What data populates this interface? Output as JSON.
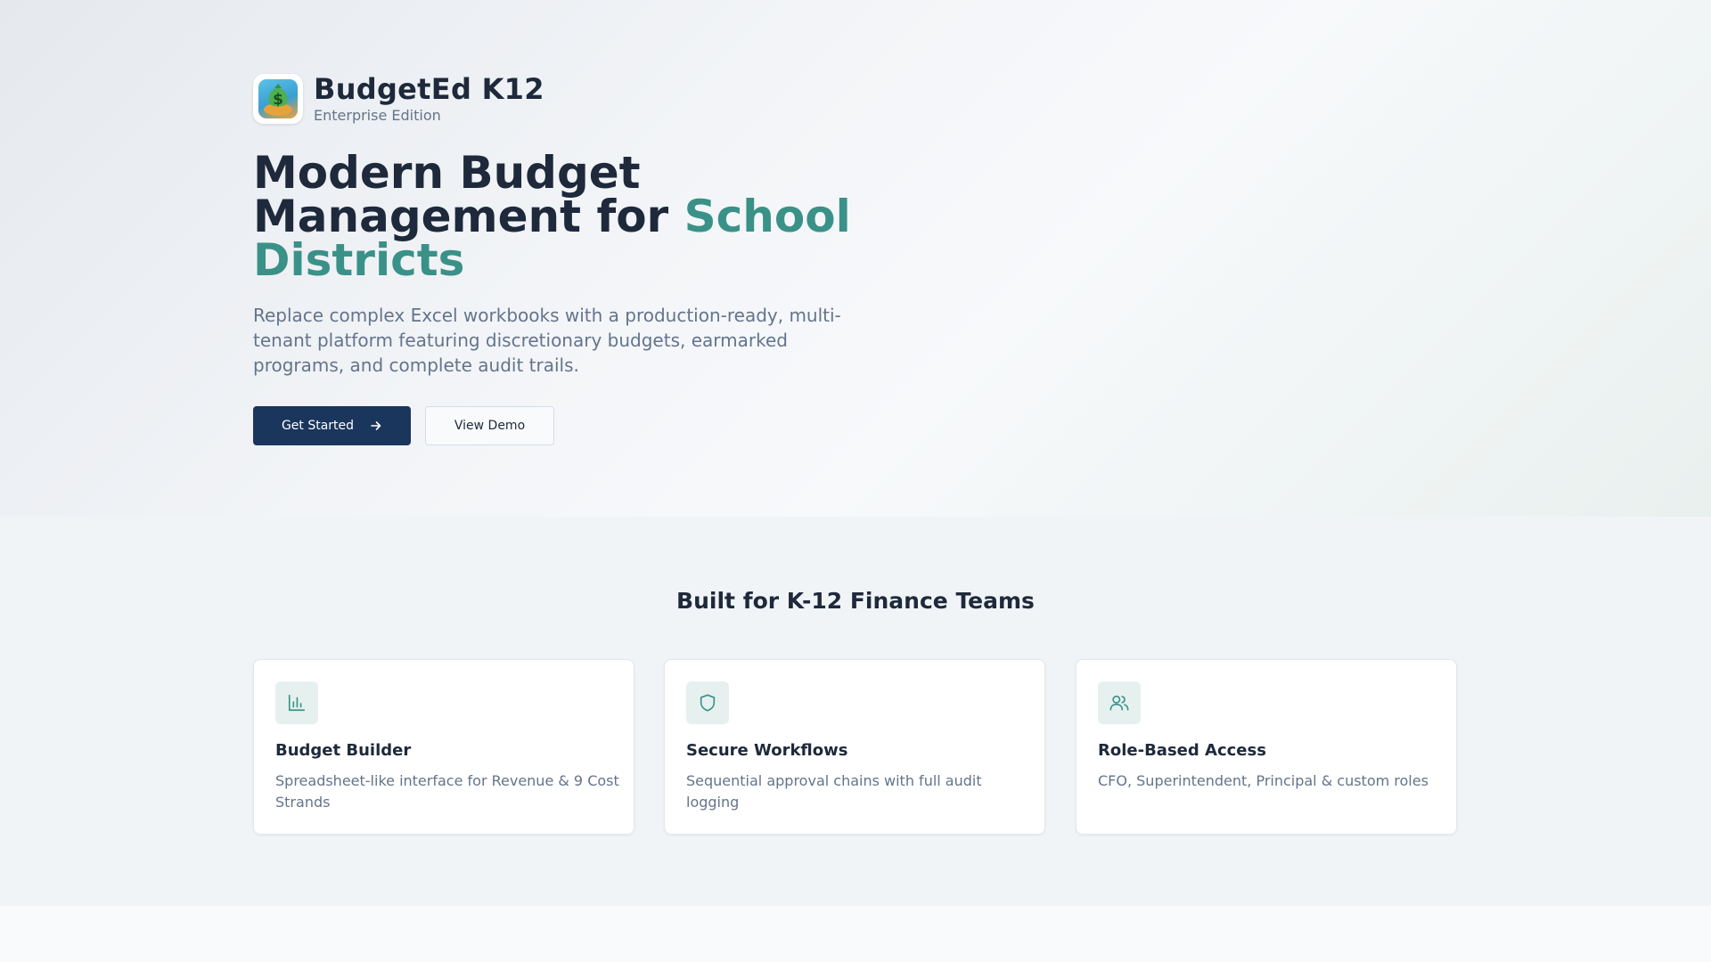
{
  "brand": {
    "name": "BudgetEd K12",
    "edition": "Enterprise Edition"
  },
  "hero": {
    "headline_part1": "Modern Budget Management for ",
    "headline_accent": "School Districts",
    "subtitle": "Replace complex Excel workbooks with a production-ready, multi-tenant platform featuring discretionary budgets, earmarked programs, and complete audit trails.",
    "primary_button": "Get Started",
    "secondary_button": "View Demo"
  },
  "features": {
    "title": "Built for K-12 Finance Teams",
    "cards": [
      {
        "icon": "bar-chart-icon",
        "title": "Budget Builder",
        "description": "Spreadsheet-like interface for Revenue & 9 Cost Strands"
      },
      {
        "icon": "shield-icon",
        "title": "Secure Workflows",
        "description": "Sequential approval chains with full audit logging"
      },
      {
        "icon": "users-icon",
        "title": "Role-Based Access",
        "description": "CFO, Superintendent, Principal & custom roles"
      }
    ]
  },
  "colors": {
    "primary": "#1b365d",
    "accent": "#3a9188",
    "text": "#1e293b",
    "muted": "#64748b"
  }
}
